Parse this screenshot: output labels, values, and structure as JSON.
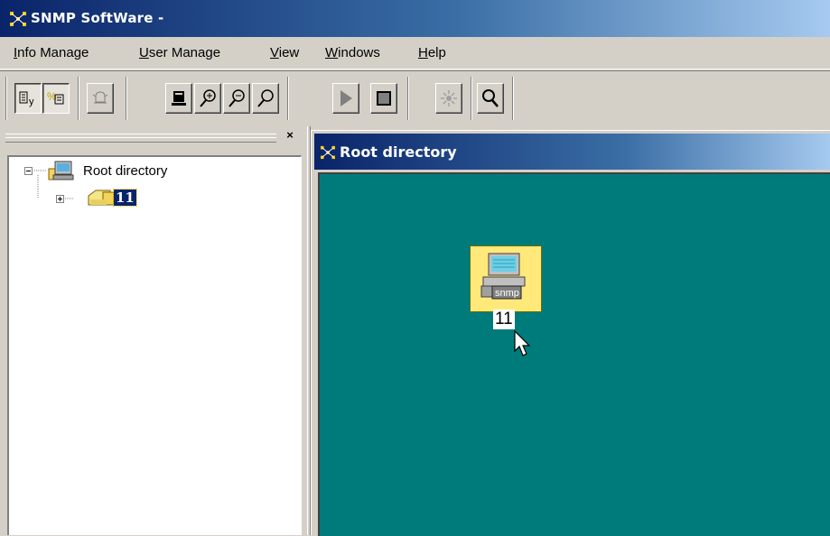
{
  "window": {
    "title": "SNMP SoftWare -"
  },
  "menu": [
    {
      "label": "Info Manage",
      "ul": "I",
      "rest": "nfo Manage"
    },
    {
      "label": "User Manage",
      "ul": "U",
      "rest": "ser Manage"
    },
    {
      "label": "View",
      "ul": "V",
      "rest": "iew"
    },
    {
      "label": "Windows",
      "ul": "W",
      "rest": "indows"
    },
    {
      "label": "Help",
      "ul": "H",
      "rest": "elp"
    }
  ],
  "toolbar": {
    "buttons": [
      {
        "icon": "list-view-icon",
        "state": "pressed"
      },
      {
        "icon": "tree-view-icon",
        "state": "pressed"
      },
      {
        "icon": "bell-alarm-icon",
        "state": "normal"
      },
      {
        "icon": "device-icon",
        "state": "normal"
      },
      {
        "icon": "zoom-in-icon",
        "state": "normal"
      },
      {
        "icon": "zoom-out-icon",
        "state": "normal"
      },
      {
        "icon": "zoom-fit-icon",
        "state": "normal"
      },
      {
        "icon": "play-icon",
        "state": "normal"
      },
      {
        "icon": "stop-icon",
        "state": "normal"
      },
      {
        "icon": "discover-sun-icon",
        "state": "normal"
      },
      {
        "icon": "search-icon",
        "state": "normal"
      }
    ]
  },
  "tree": {
    "close_label": "×",
    "root": {
      "label": "Root directory",
      "expanded": true
    },
    "children": [
      {
        "label": "11",
        "selected": true,
        "expanded": false
      }
    ]
  },
  "child_window": {
    "title": "Root directory"
  },
  "map": {
    "nodes": [
      {
        "label": "11",
        "badge": "snmp"
      }
    ]
  },
  "colors": {
    "title_active": "#0a246a",
    "face": "#d4d0c8",
    "map_background": "#007b7b",
    "node_fill": "#ffe97a",
    "selection": "#0a246a"
  }
}
